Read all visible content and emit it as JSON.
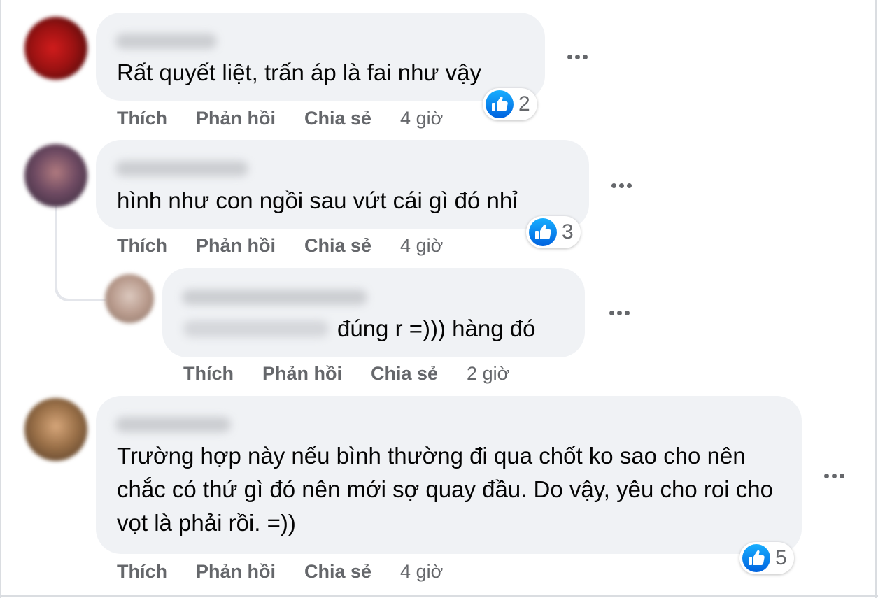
{
  "colors": {
    "bubble": "#f0f2f5",
    "action_text": "#65676b",
    "like_blue": "#1877f2"
  },
  "comments": [
    {
      "text": "Rất quyết liệt, trấn áp là fai như vậy",
      "reactions": "2",
      "actions": {
        "like": "Thích",
        "reply": "Phản hồi",
        "share": "Chia sẻ",
        "time": "4 giờ"
      }
    },
    {
      "text": "hình như con ngồi sau vứt cái gì đó nhỉ",
      "reactions": "3",
      "actions": {
        "like": "Thích",
        "reply": "Phản hồi",
        "share": "Chia sẻ",
        "time": "4 giờ"
      }
    },
    {
      "text": "đúng r =))) hàng đó",
      "actions": {
        "like": "Thích",
        "reply": "Phản hồi",
        "share": "Chia sẻ",
        "time": "2 giờ"
      }
    },
    {
      "text": "Trường hợp này nếu bình thường đi qua chốt ko sao cho nên chắc có thứ gì đó nên mới sợ quay đầu. Do vậy, yêu cho roi cho vọt là phải rồi. =))",
      "reactions": "5",
      "actions": {
        "like": "Thích",
        "reply": "Phản hồi",
        "share": "Chia sẻ",
        "time": "4 giờ"
      }
    }
  ],
  "icons": {
    "more": "more-horizontal-icon",
    "like": "thumbs-up-icon"
  }
}
